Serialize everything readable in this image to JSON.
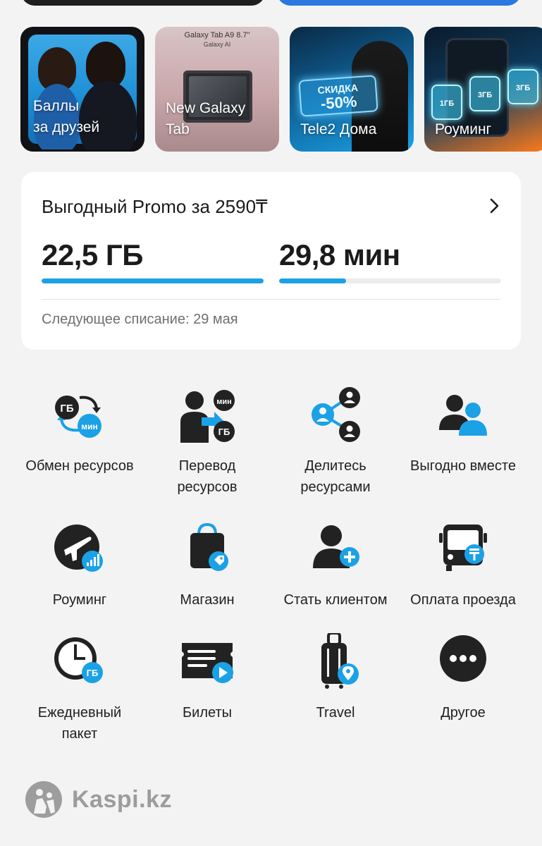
{
  "stories": [
    {
      "id": "friends",
      "lines": [
        "Баллы",
        "за друзей"
      ]
    },
    {
      "id": "galaxy",
      "lines": [
        "New Galaxy",
        "Tab"
      ],
      "header": "Galaxy Tab A9 8.7\"",
      "subheader": "Galaxy AI"
    },
    {
      "id": "home",
      "lines": [
        "Tele2 Дома"
      ],
      "promo_line1": "СКИДКА",
      "promo_line2": "-50%"
    },
    {
      "id": "roaming",
      "lines": [
        "Роуминг"
      ],
      "tags": [
        "1ГБ",
        "3ГБ",
        "3ГБ"
      ]
    }
  ],
  "tariff": {
    "title": "Выгодный Promo за 2590₸",
    "data_value": "22,5 ГБ",
    "minutes_value": "29,8 мин",
    "data_fraction": 1.0,
    "minutes_fraction": 0.3,
    "next_charge": "Следующее списание: 29 мая"
  },
  "services": [
    {
      "icon": "exchange-icon",
      "lines": [
        "Обмен ресурсов"
      ]
    },
    {
      "icon": "transfer-icon",
      "lines": [
        "Перевод",
        "ресурсов"
      ]
    },
    {
      "icon": "share-icon",
      "lines": [
        "Делитесь",
        "ресурсами"
      ]
    },
    {
      "icon": "together-icon",
      "lines": [
        "Выгодно вместе"
      ]
    },
    {
      "icon": "roaming-icon",
      "lines": [
        "Роуминг"
      ]
    },
    {
      "icon": "shop-icon",
      "lines": [
        "Магазин"
      ]
    },
    {
      "icon": "add-client-icon",
      "lines": [
        "Стать клиентом"
      ]
    },
    {
      "icon": "bus-payment-icon",
      "lines": [
        "Оплата проезда"
      ]
    },
    {
      "icon": "daily-package-icon",
      "lines": [
        "Ежедневный",
        "пакет"
      ]
    },
    {
      "icon": "tickets-icon",
      "lines": [
        "Билеты"
      ]
    },
    {
      "icon": "travel-icon",
      "lines": [
        "Travel"
      ]
    },
    {
      "icon": "more-icon",
      "lines": [
        "Другое"
      ]
    }
  ],
  "icon_text": {
    "gb": "ГБ",
    "min": "мин"
  },
  "watermark": "Kaspi.kz",
  "colors": {
    "accent": "#1ba1e6",
    "dark": "#1e1e1e",
    "background": "#f3f3f3"
  }
}
